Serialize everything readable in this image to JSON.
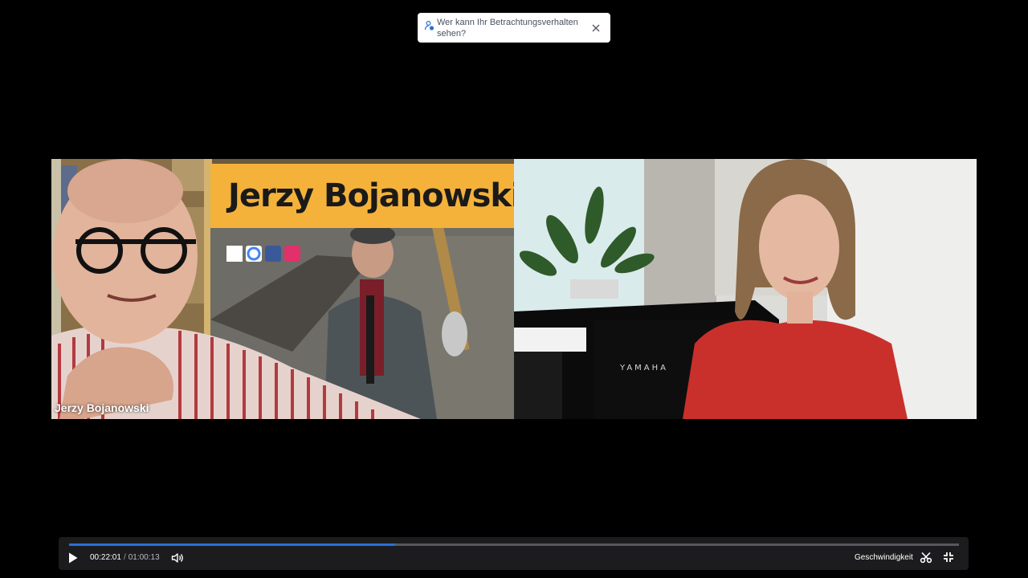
{
  "toast": {
    "text": "Wer kann Ihr Betrachtungsverhalten sehen?",
    "icon": "user-privacy-icon",
    "close_icon": "close-icon"
  },
  "video": {
    "left_participant_name": "Jerzy Bojanowski",
    "banner_text": "Jerzy Bojanowski",
    "piano_brand": "YAMAHA"
  },
  "player": {
    "current_time": "00:22:01",
    "time_separator": "/",
    "duration": "01:00:13",
    "progress_fraction": 0.366,
    "speed_label": "Geschwindigkeit",
    "accent_color": "#2b6fd6",
    "icons": {
      "play": "play-icon",
      "volume": "volume-icon",
      "clip": "scissors-icon",
      "exit_fullscreen": "exit-fullscreen-icon"
    }
  }
}
